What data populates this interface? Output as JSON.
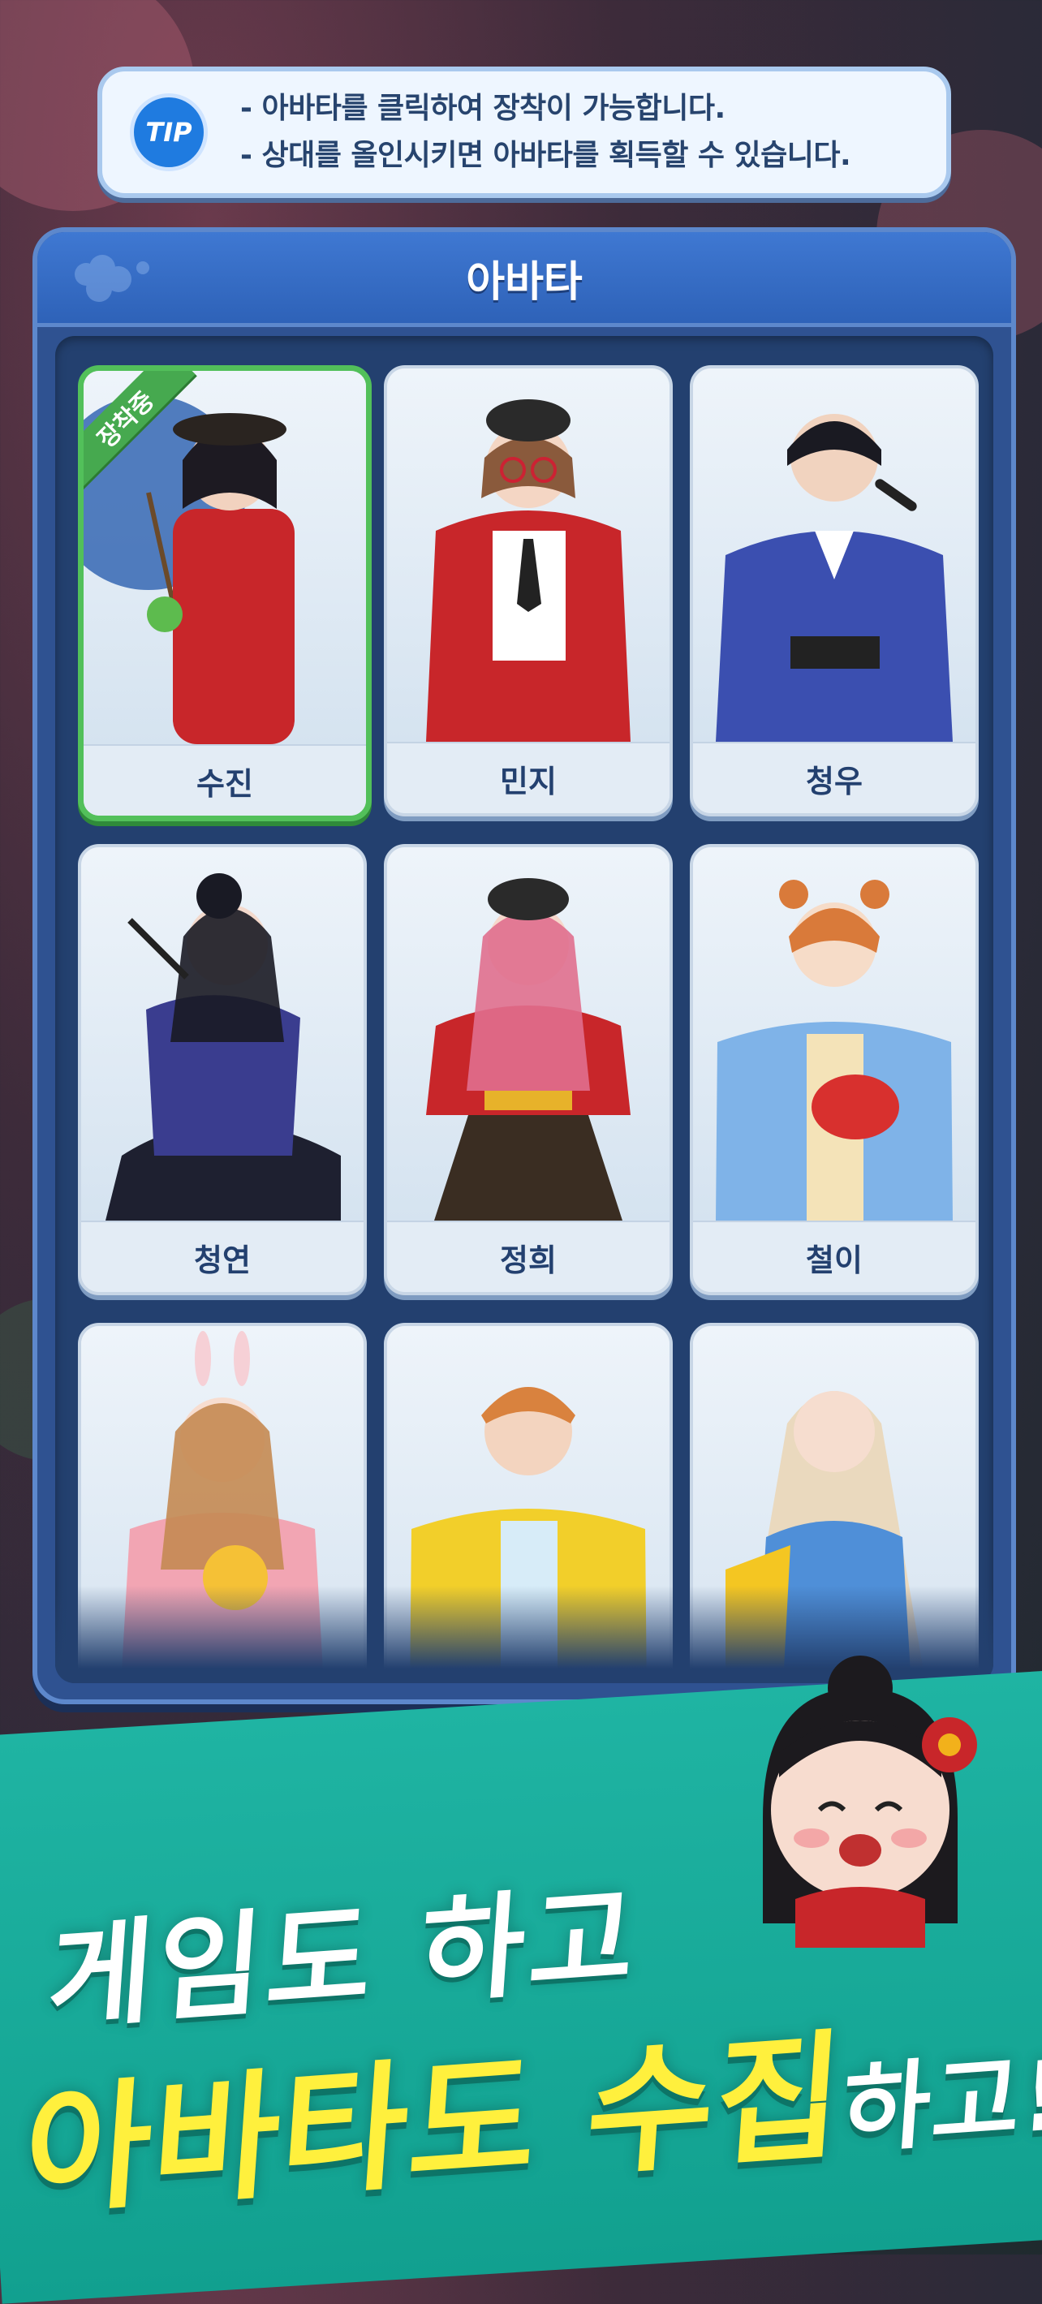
{
  "tip": {
    "badge": "TIP",
    "lines": [
      "- 아바타를 클릭하여 장착이 가능합니다.",
      "- 상대를 올인시키면 아바타를 획득할 수 있습니다."
    ]
  },
  "panel": {
    "title": "아바타",
    "equipped_badge": "장착중",
    "avatars": [
      {
        "name": "수진",
        "equipped": true
      },
      {
        "name": "민지",
        "equipped": false
      },
      {
        "name": "청우",
        "equipped": false
      },
      {
        "name": "청연",
        "equipped": false
      },
      {
        "name": "정희",
        "equipped": false
      },
      {
        "name": "철이",
        "equipped": false
      },
      {
        "name": "",
        "equipped": false
      },
      {
        "name": "",
        "equipped": false
      },
      {
        "name": "",
        "equipped": false
      }
    ]
  },
  "promo": {
    "line1": "게임도 하고",
    "line2_main": "아바타도 수집",
    "line2_suffix": "하고!"
  },
  "colors": {
    "panel": "#2f5291",
    "equipped_border": "#52c05a",
    "promo_band": "#1fb4a3",
    "promo_highlight": "#fff03d"
  }
}
